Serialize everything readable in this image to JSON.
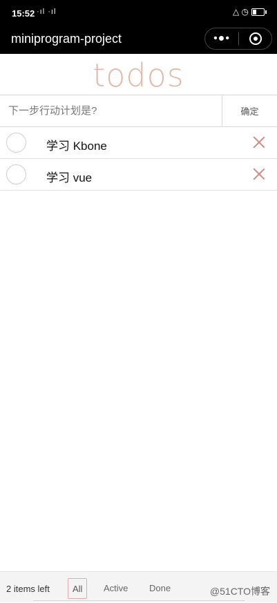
{
  "status_bar": {
    "time": "15:52",
    "signal": "·ıl ·ıl",
    "right_icons": "△ ◷"
  },
  "nav": {
    "title": "miniprogram-project",
    "more_icon": "•●•"
  },
  "app": {
    "title": "todos",
    "input_placeholder": "下一步行动计划是?",
    "confirm_label": "确定"
  },
  "todos": [
    {
      "label": "学习 Kbone",
      "done": false
    },
    {
      "label": "学习 vue",
      "done": false
    }
  ],
  "footer": {
    "items_left": "2 items left",
    "filters": [
      "All",
      "Active",
      "Done"
    ],
    "selected_filter": "All",
    "watermark": "@51CTO博客"
  },
  "colors": {
    "accent": "#e0b9a8",
    "delete": "#d08b84",
    "selected_border": "#e2aaa6"
  }
}
